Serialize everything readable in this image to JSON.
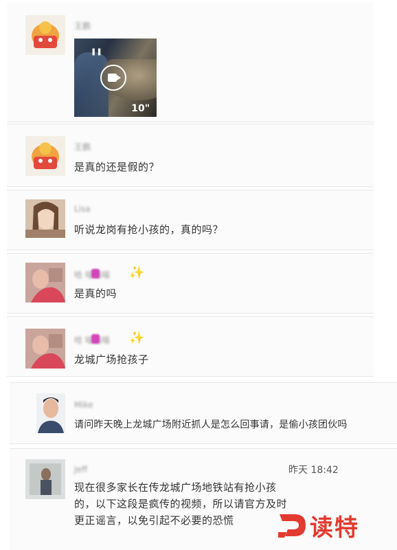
{
  "comments": [
    {
      "name": "王鹏",
      "video_duration": "10\"",
      "avatar": "mascot"
    },
    {
      "name": "王鹏",
      "text": "是真的还是假的？",
      "avatar": "mascot"
    },
    {
      "name": "Lisa",
      "text": "听说龙岗有抢小孩的，真的吗？",
      "avatar": "woman"
    },
    {
      "name": "哈 喵喵喵",
      "text": "是真的吗",
      "avatar": "child"
    },
    {
      "name": "哈 喵喵喵",
      "text": "龙城广场抢孩子",
      "avatar": "child"
    },
    {
      "name": "Mike",
      "text": "请问昨天晚上龙城广场附近抓人是怎么回事请，是偷小孩团伙吗",
      "avatar": "man"
    },
    {
      "name": "Jeff",
      "time": "昨天 18:42",
      "text": "现在很多家长在传龙城广场地铁站有抢小孩的，以下这段是疯传的视频，所以请官方及时更正谣言，以免引起不必要的恐慌",
      "avatar": "person"
    }
  ],
  "watermark": {
    "text": "读特",
    "color": "#e33a2f"
  }
}
